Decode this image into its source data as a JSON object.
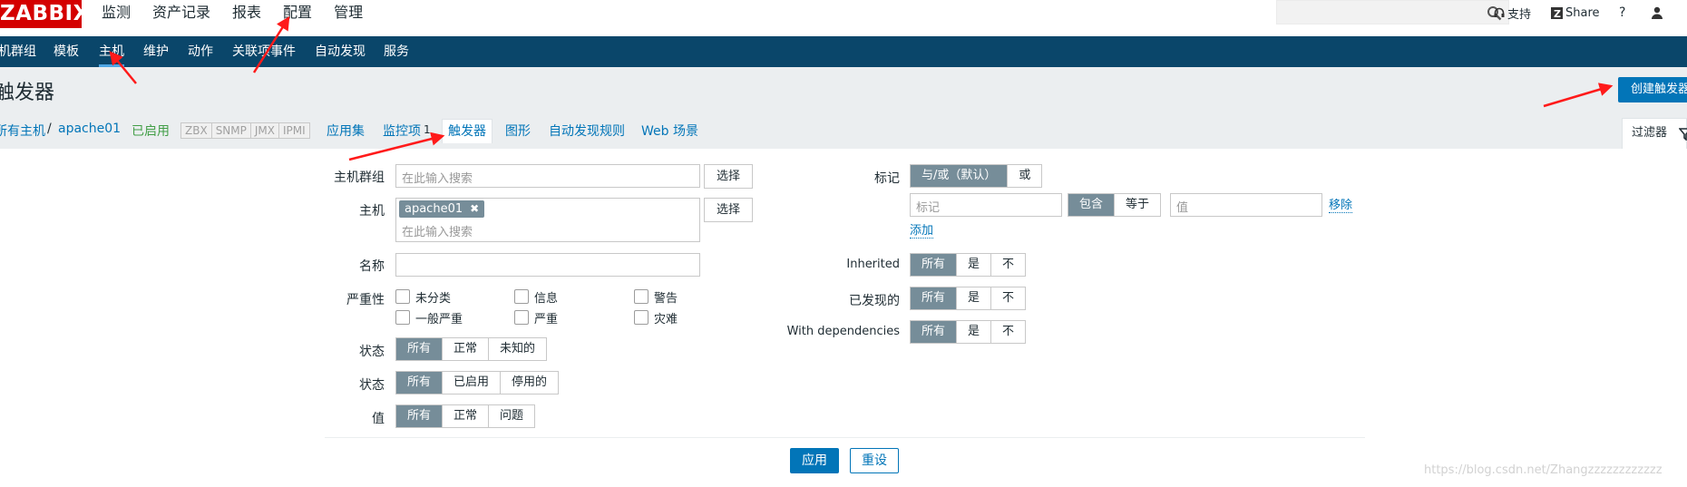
{
  "top": {
    "logo": "ZABBIX",
    "menu": [
      "监测",
      "资产记录",
      "报表",
      "配置",
      "管理"
    ],
    "support": "支持",
    "share": "Share",
    "help": "?"
  },
  "subnav": [
    "机群组",
    "模板",
    "主机",
    "维护",
    "动作",
    "关联项事件",
    "自动发现",
    "服务"
  ],
  "header": {
    "title": "触发器",
    "create_button": "创建触发器"
  },
  "crumbs": {
    "all_hosts": "所有主机",
    "sep": "/",
    "host": "apache01",
    "enabled": "已启用",
    "availability": [
      "ZBX",
      "SNMP",
      "JMX",
      "IPMI"
    ],
    "tabs": [
      {
        "label": "应用集"
      },
      {
        "label": "监控项",
        "count": "1"
      },
      {
        "label": "触发器"
      },
      {
        "label": "图形"
      },
      {
        "label": "自动发现规则"
      },
      {
        "label": "Web 场景"
      }
    ],
    "filter_tab": "过滤器"
  },
  "filter": {
    "host_group_label": "主机群组",
    "host_group_placeholder": "在此输入搜索",
    "select": "选择",
    "host_label": "主机",
    "host_chip": "apache01",
    "host_placeholder": "在此输入搜索",
    "name_label": "名称",
    "severity_label": "严重性",
    "severities": [
      "未分类",
      "信息",
      "警告",
      "一般严重",
      "严重",
      "灾难"
    ],
    "state_label": "状态",
    "state_options": [
      "所有",
      "正常",
      "未知的"
    ],
    "status_label": "状态",
    "status_options": [
      "所有",
      "已启用",
      "停用的"
    ],
    "value_label": "值",
    "value_options": [
      "所有",
      "正常",
      "问题"
    ],
    "tags_label": "标记",
    "tags_options": [
      "与/或（默认）",
      "或"
    ],
    "tag_placeholder": "标记",
    "tag_ops": [
      "包含",
      "等于"
    ],
    "value_placeholder": "值",
    "remove": "移除",
    "add": "添加",
    "inherited_label": "Inherited",
    "discovered_label": "已发现的",
    "deps_label": "With dependencies",
    "yn_options": [
      "所有",
      "是",
      "不"
    ],
    "apply": "应用",
    "reset": "重设"
  },
  "watermark": "https://blog.csdn.net/Zhangzzzzzzzzzzzz",
  "colors": {
    "logo": "#d40000",
    "nav": "#0a466a",
    "primary": "#0275b8",
    "segment_on": "#768d99",
    "annotation": "#ff1a1a"
  }
}
